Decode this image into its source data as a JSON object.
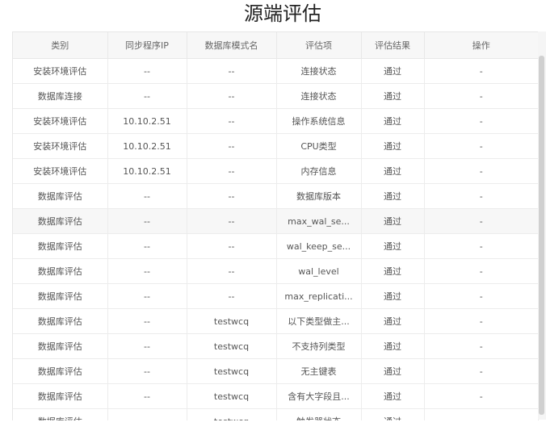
{
  "title": "源端评估",
  "columns": [
    "类别",
    "同步程序IP",
    "数据库模式名",
    "评估项",
    "评估结果",
    "操作"
  ],
  "rows": [
    [
      "安装环境评估",
      "--",
      "--",
      "连接状态",
      "通过",
      "-"
    ],
    [
      "数据库连接",
      "--",
      "--",
      "连接状态",
      "通过",
      "-"
    ],
    [
      "安装环境评估",
      "10.10.2.51",
      "--",
      "操作系统信息",
      "通过",
      "-"
    ],
    [
      "安装环境评估",
      "10.10.2.51",
      "--",
      "CPU类型",
      "通过",
      "-"
    ],
    [
      "安装环境评估",
      "10.10.2.51",
      "--",
      "内存信息",
      "通过",
      "-"
    ],
    [
      "数据库评估",
      "--",
      "--",
      "数据库版本",
      "通过",
      "-"
    ],
    [
      "数据库评估",
      "--",
      "--",
      "max_wal_se...",
      "通过",
      "-"
    ],
    [
      "数据库评估",
      "--",
      "--",
      "wal_keep_se...",
      "通过",
      "-"
    ],
    [
      "数据库评估",
      "--",
      "--",
      "wal_level",
      "通过",
      "-"
    ],
    [
      "数据库评估",
      "--",
      "--",
      "max_replicati...",
      "通过",
      "-"
    ],
    [
      "数据库评估",
      "--",
      "testwcq",
      "以下类型做主...",
      "通过",
      "-"
    ],
    [
      "数据库评估",
      "--",
      "testwcq",
      "不支持列类型",
      "通过",
      "-"
    ],
    [
      "数据库评估",
      "--",
      "testwcq",
      "无主键表",
      "通过",
      "-"
    ],
    [
      "数据库评估",
      "--",
      "testwcq",
      "含有大字段且...",
      "通过",
      "-"
    ],
    [
      "数据库评估",
      "--",
      "testwcq",
      "触发器状态",
      "通过",
      "-"
    ]
  ]
}
